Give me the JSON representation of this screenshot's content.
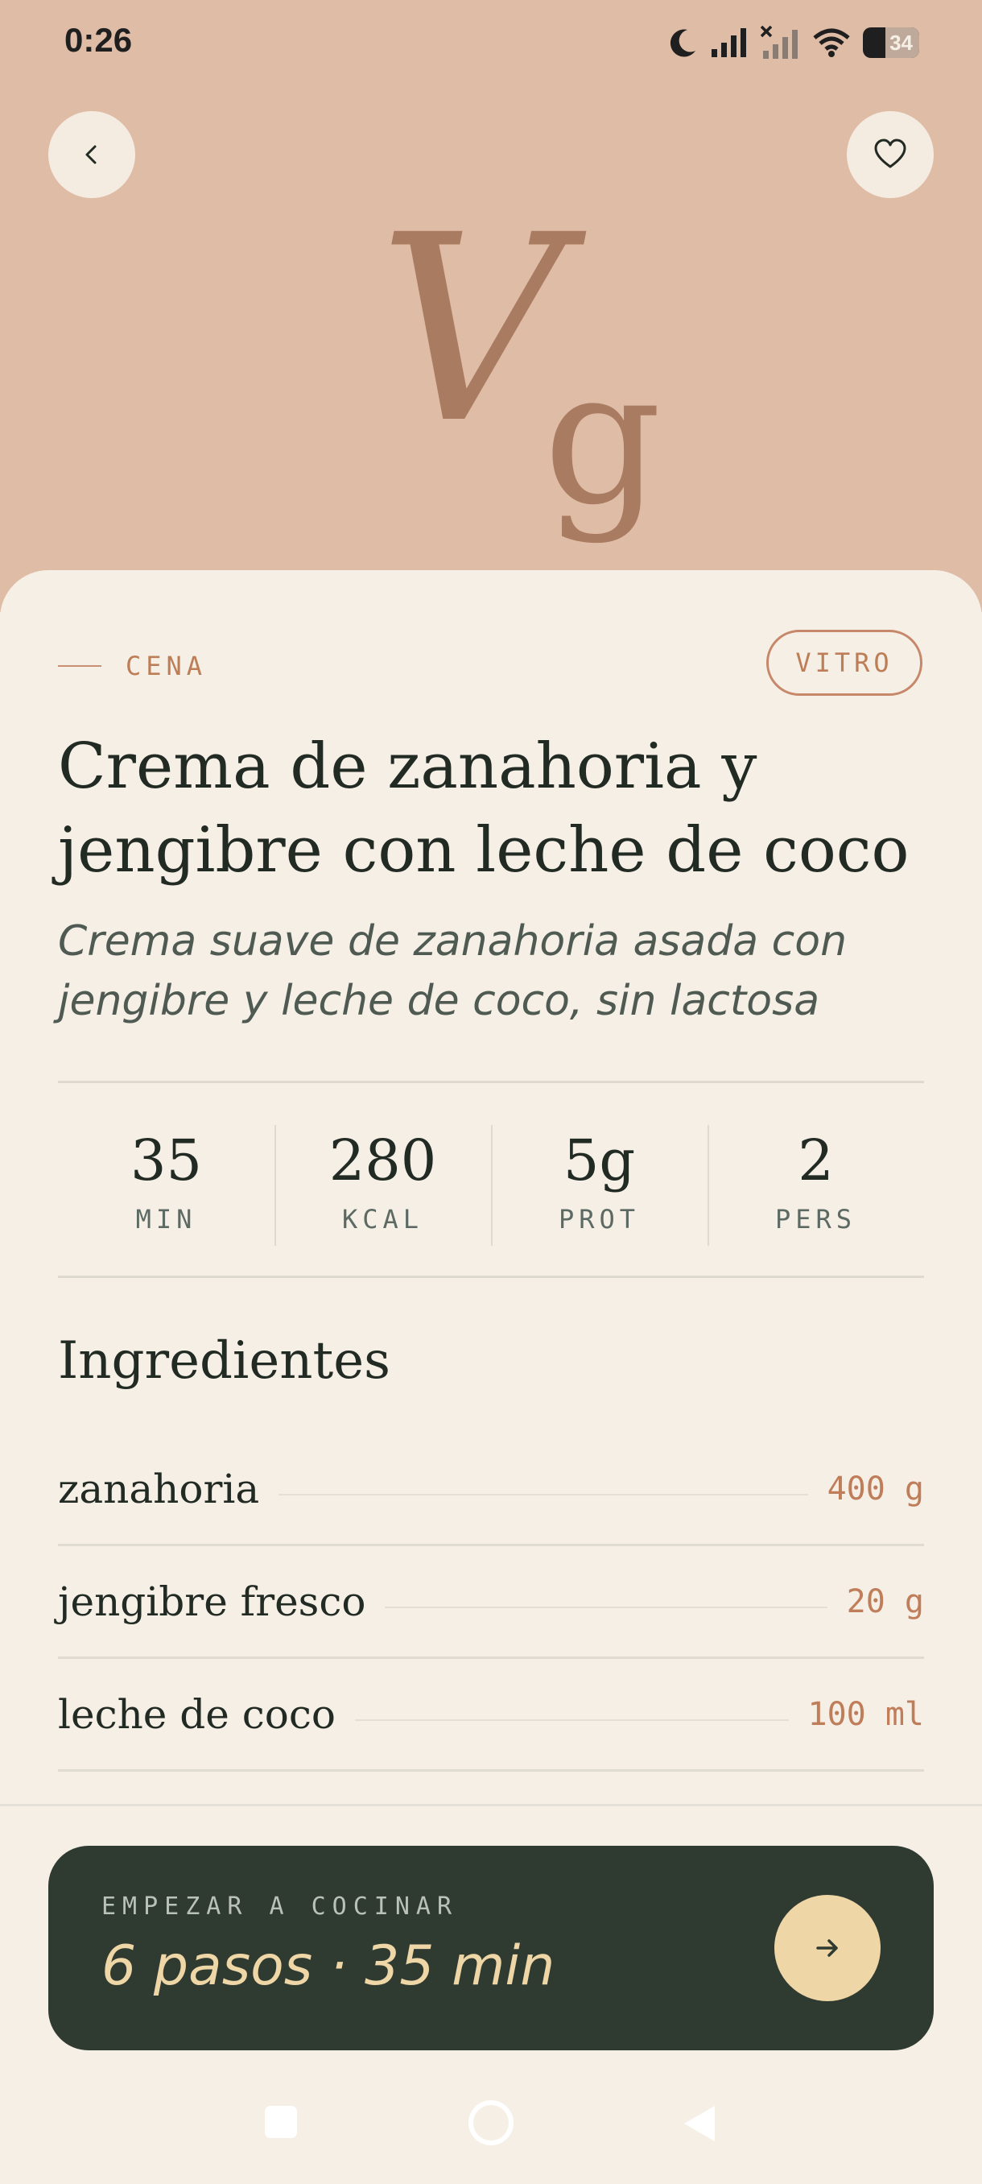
{
  "status_bar": {
    "time": "0:26",
    "battery_level": "34",
    "icons": [
      "moon-icon",
      "signal-icon",
      "no-signal-icon",
      "wifi-icon",
      "battery-icon"
    ]
  },
  "header": {
    "back_icon": "chevron-left-icon",
    "favorite_icon": "heart-outline-icon",
    "monogram_big": "V",
    "monogram_small": "g"
  },
  "recipe": {
    "category": "CENA",
    "badge": "VITRO",
    "title": "Crema de zanahoria y jengibre con leche de coco",
    "subtitle": "Crema suave de zanahoria asada con jengibre y leche de coco, sin lactosa",
    "stats": [
      {
        "value": "35",
        "unit": "MIN"
      },
      {
        "value": "280",
        "unit": "KCAL"
      },
      {
        "value": "5g",
        "unit": "PROT"
      },
      {
        "value": "2",
        "unit": "PERS"
      }
    ]
  },
  "ingredients": {
    "heading": "Ingredientes",
    "items": [
      {
        "name": "zanahoria",
        "qty": "400 g"
      },
      {
        "name": "jengibre fresco",
        "qty": "20 g"
      },
      {
        "name": "leche de coco",
        "qty": "100 ml"
      }
    ]
  },
  "cta": {
    "label": "EMPEZAR A COCINAR",
    "detail": "6 pasos · 35 min",
    "arrow_icon": "arrow-right-icon"
  },
  "nav": {
    "icons": [
      "recents-square-icon",
      "home-circle-icon",
      "back-triangle-icon"
    ]
  },
  "colors": {
    "hero": "#dfbca6",
    "sheet": "#f5efe5",
    "accent": "#bd7d57",
    "cta_bg": "#2f3a31",
    "cta_text": "#efd6a6"
  }
}
